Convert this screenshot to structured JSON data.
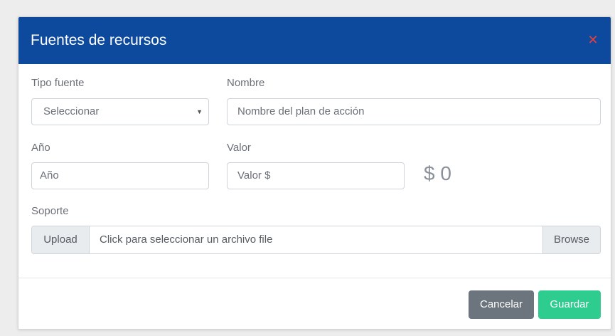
{
  "modal": {
    "title": "Fuentes de recursos",
    "close_symbol": "✕",
    "close_icon": "close-icon",
    "colors": {
      "header_bg": "#0d4a9e",
      "close": "#e8413c",
      "cancel_bg": "#6c757d",
      "save_bg": "#2ecc8f"
    }
  },
  "form": {
    "tipo_fuente": {
      "label": "Tipo fuente",
      "selected": "Seleccionar",
      "arrow": "▼"
    },
    "nombre": {
      "label": "Nombre",
      "placeholder": "Nombre del plan de acción"
    },
    "anio": {
      "label": "Año",
      "placeholder": "Año"
    },
    "valor": {
      "label": "Valor",
      "placeholder": "Valor $",
      "display": "$ 0"
    },
    "soporte": {
      "label": "Soporte",
      "upload_label": "Upload",
      "file_text": "Click para seleccionar un archivo file",
      "browse_label": "Browse"
    }
  },
  "footer": {
    "cancel_label": "Cancelar",
    "save_label": "Guardar"
  }
}
